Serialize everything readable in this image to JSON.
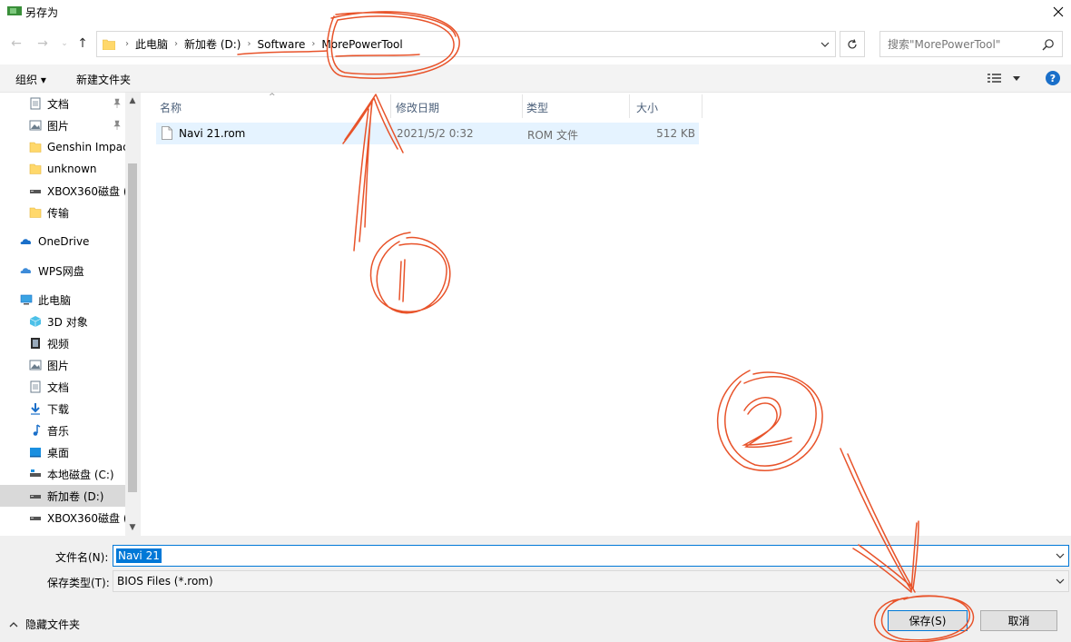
{
  "window": {
    "title": "另存为"
  },
  "address": {
    "crumbs": [
      "此电脑",
      "新加卷 (D:)",
      "Software",
      "MorePowerTool"
    ]
  },
  "search": {
    "placeholder": "搜索\"MorePowerTool\""
  },
  "commands": {
    "organize": "组织 ▾",
    "new_folder": "新建文件夹"
  },
  "help": "?",
  "sidebar": {
    "items": [
      {
        "label": "文档",
        "icon": "document-icon",
        "pinned": true
      },
      {
        "label": "图片",
        "icon": "pictures-icon",
        "pinned": true
      },
      {
        "label": "Genshin Impac",
        "icon": "folder-icon"
      },
      {
        "label": "unknown",
        "icon": "folder-icon"
      },
      {
        "label": "XBOX360磁盘 (",
        "icon": "drive-icon"
      },
      {
        "label": "传输",
        "icon": "folder-icon"
      },
      {
        "label": "OneDrive",
        "icon": "onedrive-icon"
      },
      {
        "label": "WPS网盘",
        "icon": "wps-cloud-icon"
      },
      {
        "label": "此电脑",
        "icon": "computer-icon"
      },
      {
        "label": "3D 对象",
        "icon": "3d-objects-icon"
      },
      {
        "label": "视频",
        "icon": "videos-icon"
      },
      {
        "label": "图片",
        "icon": "pictures-icon"
      },
      {
        "label": "文档",
        "icon": "document-icon"
      },
      {
        "label": "下载",
        "icon": "download-icon"
      },
      {
        "label": "音乐",
        "icon": "music-icon"
      },
      {
        "label": "桌面",
        "icon": "desktop-icon"
      },
      {
        "label": "本地磁盘 (C:)",
        "icon": "system-drive-icon"
      },
      {
        "label": "新加卷 (D:)",
        "icon": "drive-icon",
        "selected": true
      },
      {
        "label": "XBOX360磁盘 (",
        "icon": "drive-icon"
      }
    ]
  },
  "columns": [
    "名称",
    "修改日期",
    "类型",
    "大小"
  ],
  "files": [
    {
      "name": "Navi 21.rom",
      "modified": "2021/5/2 0:32",
      "type": "ROM 文件",
      "size": "512 KB"
    }
  ],
  "form": {
    "filename_label": "文件名(N):",
    "filename_value": "Navi 21",
    "filetype_label": "保存类型(T):",
    "filetype_value": "BIOS Files (*.rom)"
  },
  "footer": {
    "hide_folders": "隐藏文件夹",
    "save": "保存(S)",
    "cancel": "取消"
  },
  "annotations": {
    "marker_1": "1",
    "marker_2": "2",
    "color": "#e8532a"
  }
}
